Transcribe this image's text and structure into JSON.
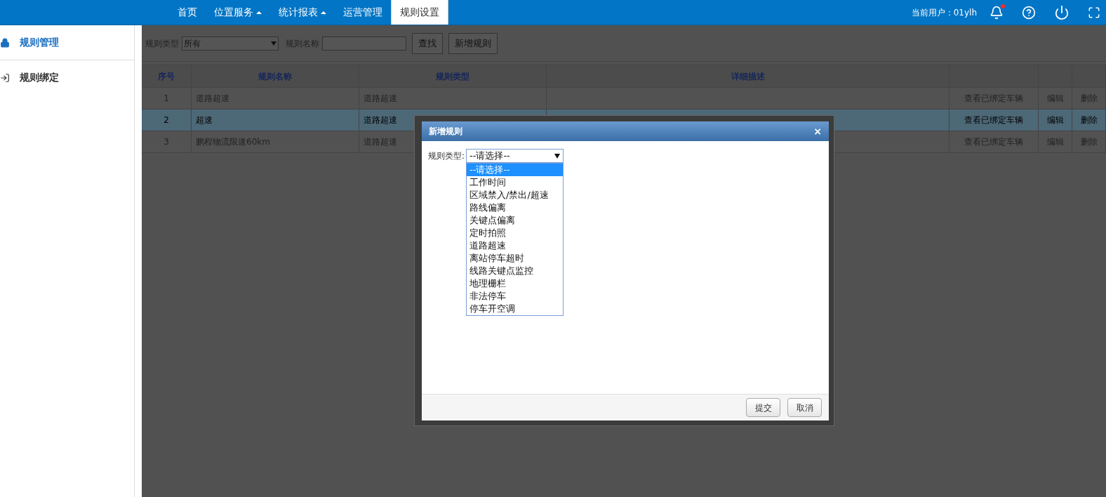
{
  "nav": {
    "items": [
      {
        "label": "首页",
        "dropdown": false,
        "selected": false
      },
      {
        "label": "位置服务",
        "dropdown": true,
        "selected": false
      },
      {
        "label": "统计报表",
        "dropdown": true,
        "selected": false
      },
      {
        "label": "运营管理",
        "dropdown": false,
        "selected": false
      },
      {
        "label": "规则设置",
        "dropdown": false,
        "selected": true
      }
    ],
    "user": "当前用户：01ylh",
    "notification": true
  },
  "sidebar": {
    "items": [
      {
        "label": "规则管理",
        "selected": true
      },
      {
        "label": "规则绑定",
        "selected": false
      }
    ]
  },
  "filter": {
    "type_label": "规则类型",
    "type_value": "所有",
    "name_label": "规则名称",
    "buttons": [
      "查找",
      "新增规则"
    ]
  },
  "table": {
    "columns": [
      "序号",
      "规则名称",
      "规则类型",
      "详细描述"
    ],
    "rows": [
      {
        "cells": [
          "1",
          "道路超速",
          "道路超速",
          ""
        ],
        "actions": [
          "查看已绑定车辆",
          "编辑",
          "删除"
        ],
        "selected": false
      },
      {
        "cells": [
          "2",
          "超速",
          "道路超速",
          ""
        ],
        "actions": [
          "查看已绑定车辆",
          "编辑",
          "删除"
        ],
        "selected": true
      },
      {
        "cells": [
          "3",
          "鹏程物流限速60km",
          "道路超速",
          ""
        ],
        "actions": [
          "查看已绑定车辆",
          "编辑",
          "删除"
        ],
        "selected": false
      }
    ]
  },
  "dialog": {
    "title": "新增规则",
    "close": "×",
    "field_label": "规则类型:",
    "field_value": "--请选择--",
    "expanded": true,
    "options": [
      {
        "label": "--请选择--",
        "selected": true
      },
      {
        "label": "工作时间",
        "selected": false
      },
      {
        "label": "区域禁入/禁出/超速",
        "selected": false
      },
      {
        "label": "路线偏离",
        "selected": false
      },
      {
        "label": "关键点偏离",
        "selected": false
      },
      {
        "label": "定时拍照",
        "selected": false
      },
      {
        "label": "道路超速",
        "selected": false
      },
      {
        "label": "离站停车超时",
        "selected": false
      },
      {
        "label": "线路关键点监控",
        "selected": false
      },
      {
        "label": "地理栅栏",
        "selected": false
      },
      {
        "label": "非法停车",
        "selected": false
      },
      {
        "label": "停车开空调",
        "selected": false
      }
    ],
    "buttons": [
      "提交",
      "取消"
    ]
  }
}
